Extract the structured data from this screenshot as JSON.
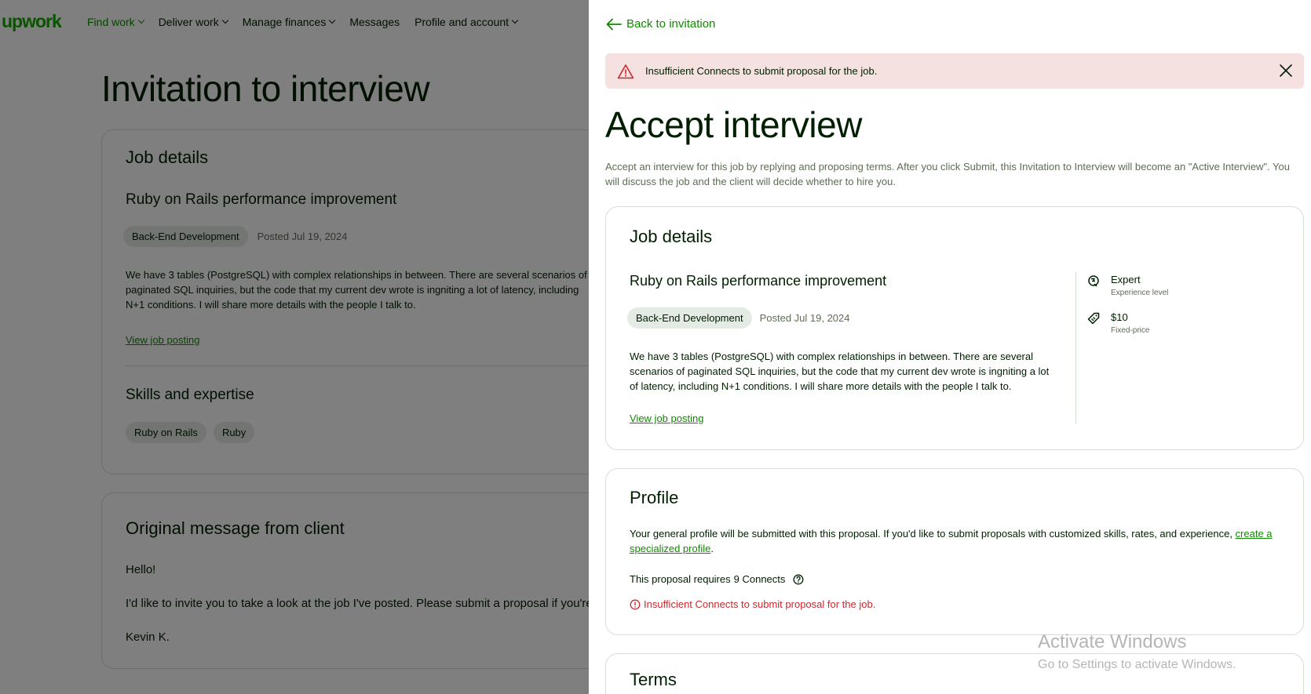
{
  "nav": {
    "logo": "upwork",
    "items": [
      {
        "label": "Find work"
      },
      {
        "label": "Deliver work"
      },
      {
        "label": "Manage finances"
      },
      {
        "label": "Messages"
      },
      {
        "label": "Profile and account"
      }
    ]
  },
  "background": {
    "title": "Invitation to interview",
    "job_details_heading": "Job details",
    "job_title": "Ruby on Rails performance improvement",
    "category": "Back-End Development",
    "posted": "Posted Jul 19, 2024",
    "description": "We have 3 tables (PostgreSQL) with complex relationships in between. There are several scenarios of paginated SQL inquiries, but the code that my current dev wrote is ingniting a lot of latency, including N+1 conditions. I will share more details with the people I talk to.",
    "view_link": "View job posting",
    "skills_heading": "Skills and expertise",
    "skills": [
      "Ruby on Rails",
      "Ruby"
    ],
    "message_heading": "Original message from client",
    "message_lines": [
      "Hello!",
      "I'd like to invite you to take a look at the job I've posted. Please submit a proposal if you're available and interested.",
      "Kevin K."
    ]
  },
  "drawer": {
    "back_label": "Back to invitation",
    "alert_text": "Insufficient Connects to submit proposal for the job.",
    "title": "Accept interview",
    "intro": "Accept an interview for this job by replying and proposing terms. After you click Submit, this Invitation to Interview will become an \"Active Interview\". You will discuss the job and the client will decide whether to hire you.",
    "job": {
      "heading": "Job details",
      "title": "Ruby on Rails performance improvement",
      "category": "Back-End Development",
      "posted": "Posted Jul 19, 2024",
      "description": "We have 3 tables (PostgreSQL) with complex relationships in between. There are several scenarios of paginated SQL inquiries, but the code that my current dev wrote is ingniting a lot of latency, including N+1 conditions. I will share more details with the people I talk to.",
      "view_link": "View job posting",
      "experience_value": "Expert",
      "experience_label": "Experience level",
      "price_value": "$10",
      "price_label": "Fixed-price"
    },
    "profile": {
      "heading": "Profile",
      "text": "Your general profile will be submitted with this proposal. If you'd like to submit proposals with customized skills, rates, and experience, ",
      "link": "create a specialized profile",
      "text_end": ".",
      "connects_prefix": "This proposal requires",
      "connects_value": "9 Connects",
      "error": "Insufficient Connects to submit proposal for the job."
    },
    "terms_heading": "Terms"
  },
  "watermark": {
    "line1": "Activate Windows",
    "line2": "Go to Settings to activate Windows."
  },
  "colors": {
    "brand": "#14a800",
    "link": "#108a00",
    "alert_bg": "#f6e1e1",
    "error": "#c9292f"
  }
}
